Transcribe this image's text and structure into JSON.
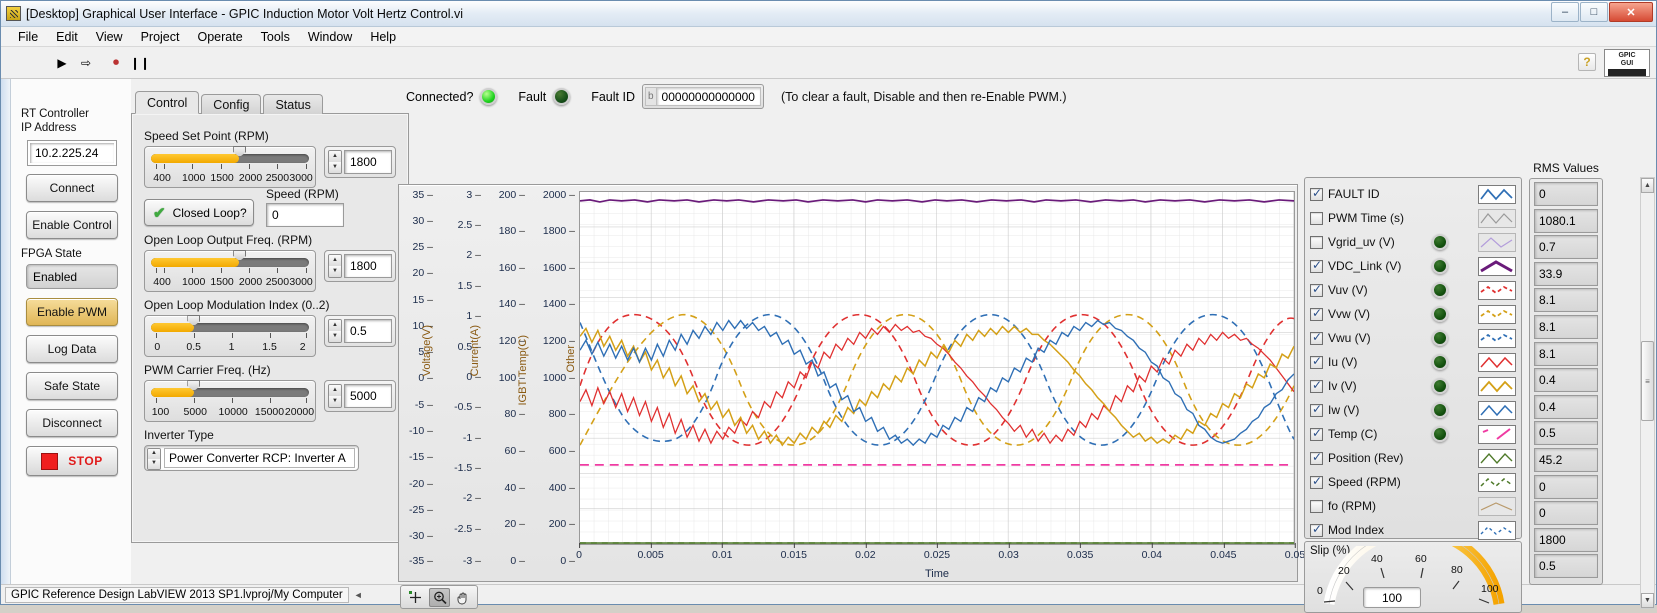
{
  "window": {
    "title": "[Desktop] Graphical User Interface - GPIC Induction Motor Volt Hertz Control.vi",
    "icon": "labview-vi-icon",
    "minimize": "–",
    "maximize": "□",
    "close": "✕"
  },
  "menu": [
    "File",
    "Edit",
    "View",
    "Project",
    "Operate",
    "Tools",
    "Window",
    "Help"
  ],
  "toolbar": {
    "run": "▶",
    "run_continuous": "⇨",
    "abort": "⏺",
    "pause": "❙❙",
    "help": "?",
    "badge_top": "GPIC",
    "badge_bottom": "GUI"
  },
  "left": {
    "ip_label_line1": "RT Controller",
    "ip_label_line2": "IP Address",
    "ip_value": "10.2.225.24",
    "connect": "Connect",
    "enable_control": "Enable Control",
    "fpga_state_label": "FPGA State",
    "fpga_state_value": "Enabled",
    "enable_pwm": "Enable PWM",
    "log_data": "Log Data",
    "safe_state": "Safe State",
    "disconnect": "Disconnect",
    "stop": "STOP"
  },
  "tabs": [
    {
      "label": "Control",
      "active": true
    },
    {
      "label": "Config",
      "active": false
    },
    {
      "label": "Status",
      "active": false
    }
  ],
  "control": {
    "speed_set_point": {
      "label": "Speed Set Point (RPM)",
      "value": "1800",
      "ticks": [
        "400",
        "1000",
        "1500",
        "2000",
        "2500",
        "3000"
      ],
      "min": 400,
      "max": 3000,
      "fill_pct": 56
    },
    "closed_loop": {
      "label": "Closed Loop?",
      "checked": true
    },
    "speed_readout": {
      "label": "Speed (RPM)",
      "value": "0"
    },
    "open_loop_freq": {
      "label": "Open Loop Output Freq. (RPM)",
      "value": "1800",
      "ticks": [
        "400",
        "1000",
        "1500",
        "2000",
        "2500",
        "3000"
      ],
      "min": 400,
      "max": 3000,
      "fill_pct": 56
    },
    "modulation_index": {
      "label": "Open Loop Modulation Index (0..2)",
      "value": "0.5",
      "ticks": [
        "0",
        "0.5",
        "1",
        "1.5",
        "2"
      ],
      "min": 0,
      "max": 2,
      "fill_pct": 27
    },
    "pwm_carrier": {
      "label": "PWM Carrier Freq. (Hz)",
      "value": "5000",
      "ticks": [
        "100",
        "5000",
        "10000",
        "15000",
        "20000"
      ],
      "min": 100,
      "max": 20000,
      "fill_pct": 27
    },
    "inverter_type": {
      "label": "Inverter Type",
      "value": "Power Converter RCP: Inverter A"
    }
  },
  "status_strip": {
    "connected_label": "Connected?",
    "connected_state": "on",
    "fault_label": "Fault",
    "fault_state": "off",
    "fault_id_label": "Fault ID",
    "fault_id_radix": "b",
    "fault_id_value": "00000000000000",
    "hint": "(To clear a fault, Disable and then re-Enable PWM.)"
  },
  "chart_data": {
    "type": "line",
    "title": "",
    "xlabel": "Time",
    "x_ticks": [
      "0",
      "0.005",
      "0.01",
      "0.015",
      "0.02",
      "0.025",
      "0.03",
      "0.035",
      "0.04",
      "0.045",
      "0.05"
    ],
    "xlim": [
      0,
      0.05
    ],
    "grid": true,
    "legend_position": "right",
    "y_axes": [
      {
        "name": "Voltage(V)",
        "ticks": [
          "35",
          "30",
          "25",
          "20",
          "15",
          "10",
          "5",
          "0",
          "-5",
          "-10",
          "-15",
          "-20",
          "-25",
          "-30",
          "-35"
        ],
        "ylim": [
          -35,
          35
        ]
      },
      {
        "name": "Current(A)",
        "ticks": [
          "3",
          "2.5",
          "2",
          "1.5",
          "1",
          "0.5",
          "0",
          "-0.5",
          "-1",
          "-1.5",
          "-2",
          "-2.5",
          "-3"
        ],
        "ylim": [
          -3,
          3
        ]
      },
      {
        "name": "IGBT Temp(C)",
        "ticks": [
          "200",
          "180",
          "160",
          "140",
          "120",
          "100",
          "80",
          "60",
          "40",
          "20",
          "0"
        ],
        "ylim": [
          0,
          200
        ]
      },
      {
        "name": "Other",
        "ticks": [
          "2000",
          "1800",
          "1600",
          "1400",
          "1200",
          "1000",
          "800",
          "600",
          "400",
          "200",
          "0"
        ],
        "ylim": [
          0,
          2000
        ]
      }
    ],
    "series": [
      {
        "name": "FAULT ID",
        "color": "#2f6fb5",
        "style": "solid",
        "visible": true,
        "axis": "Other",
        "rms": "0"
      },
      {
        "name": "PWM Time (s)",
        "color": "#9a9a9a",
        "style": "solid",
        "visible": false,
        "axis": "Other",
        "rms": "1080.1"
      },
      {
        "name": "Vgrid_uv (V)",
        "color": "#b39ddb",
        "style": "solid",
        "visible": false,
        "axis": "Voltage(V)",
        "rms": "0.7"
      },
      {
        "name": "VDC_Link (V)",
        "color": "#6a1b7a",
        "style": "solid",
        "visible": true,
        "axis": "Other",
        "rms": "33.9"
      },
      {
        "name": "Vuv (V)",
        "color": "#e03030",
        "style": "dashed",
        "visible": true,
        "axis": "Voltage(V)",
        "rms": "8.1"
      },
      {
        "name": "Vvw (V)",
        "color": "#d4a017",
        "style": "dashed",
        "visible": true,
        "axis": "Voltage(V)",
        "rms": "8.1"
      },
      {
        "name": "Vwu (V)",
        "color": "#2f6fb5",
        "style": "dashed",
        "visible": true,
        "axis": "Voltage(V)",
        "rms": "8.1"
      },
      {
        "name": "Iu (V)",
        "color": "#e03030",
        "style": "solid",
        "visible": true,
        "axis": "Current(A)",
        "rms": "0.4"
      },
      {
        "name": "Iv (V)",
        "color": "#d4a017",
        "style": "solid",
        "visible": true,
        "axis": "Current(A)",
        "rms": "0.4"
      },
      {
        "name": "Iw (V)",
        "color": "#2f6fb5",
        "style": "solid",
        "visible": true,
        "axis": "Current(A)",
        "rms": "0.5"
      },
      {
        "name": "Temp (C)",
        "color": "#ef3ba2",
        "style": "dashed",
        "visible": true,
        "axis": "IGBT Temp(C)",
        "rms": "45.2"
      },
      {
        "name": "Position (Rev)",
        "color": "#4f7a2a",
        "style": "solid",
        "visible": true,
        "axis": "Other",
        "rms": "0"
      },
      {
        "name": "Speed (RPM)",
        "color": "#4f7a2a",
        "style": "dashed",
        "visible": true,
        "axis": "Other",
        "rms": "0"
      },
      {
        "name": "fo (RPM)",
        "color": "#b99a6b",
        "style": "solid",
        "visible": false,
        "axis": "Other",
        "rms": "1800"
      },
      {
        "name": "Mod Index",
        "color": "#2f6fb5",
        "style": "dashed",
        "visible": true,
        "axis": "Other",
        "rms": "0.5"
      }
    ]
  },
  "rms": {
    "title": "RMS Values"
  },
  "graph_tools": {
    "cursor": "cursor-tool",
    "zoom": "zoom-tool",
    "pan": "pan-tool",
    "selected": "zoom-tool"
  },
  "slip_gauge": {
    "label": "Slip (%)",
    "value": "100",
    "ticks": [
      "0",
      "20",
      "40",
      "60",
      "80",
      "100"
    ],
    "min": 0,
    "max": 100
  },
  "statusbar": {
    "text": "GPIC Reference Design LabVIEW 2013 SP1.lvproj/My Computer",
    "arrow": "◄"
  }
}
